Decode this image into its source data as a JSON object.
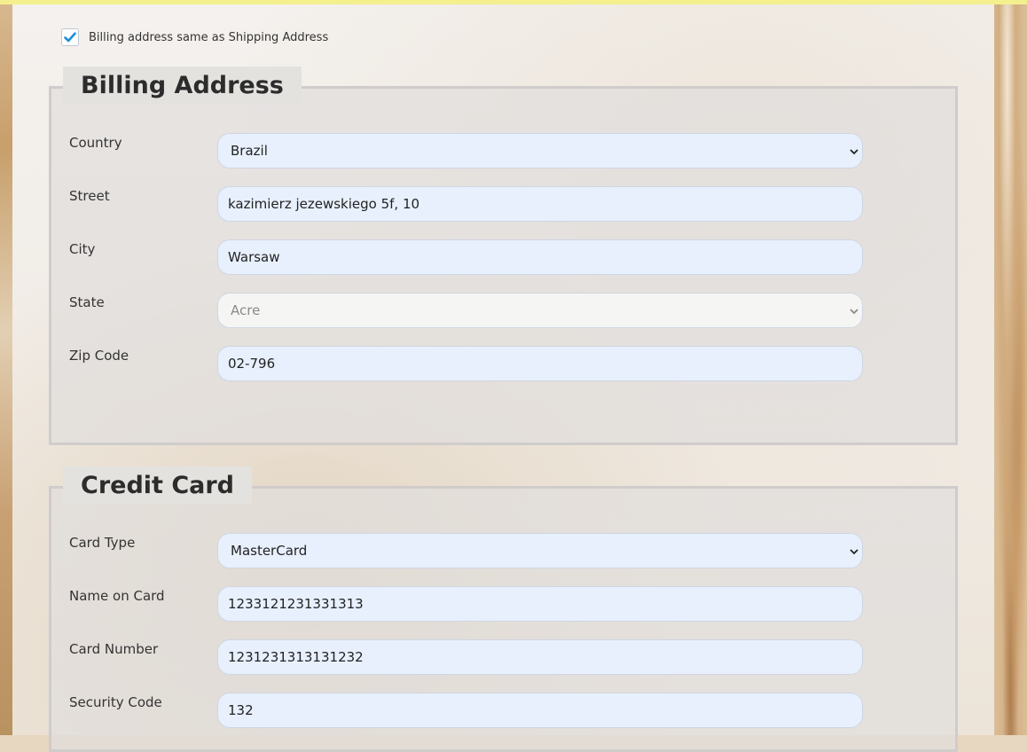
{
  "same_address": {
    "checked": true,
    "label": "Billing address same as Shipping Address"
  },
  "billing": {
    "title": "Billing Address",
    "fields": {
      "country": {
        "label": "Country",
        "value": "Brazil"
      },
      "street": {
        "label": "Street",
        "value": "kazimierz jezewskiego 5f, 10"
      },
      "city": {
        "label": "City",
        "value": "Warsaw"
      },
      "state": {
        "label": "State",
        "value": "Acre"
      },
      "zip": {
        "label": "Zip Code",
        "value": "02-796"
      }
    }
  },
  "credit_card": {
    "title": "Credit Card",
    "fields": {
      "card_type": {
        "label": "Card Type",
        "value": "MasterCard"
      },
      "name_on_card": {
        "label": "Name on Card",
        "value": "1233121231331313"
      },
      "card_number": {
        "label": "Card Number",
        "value": "1231231313131232"
      },
      "security_code": {
        "label": "Security Code",
        "value": "132"
      }
    }
  },
  "colors": {
    "input_bg": "#e8f0fe",
    "fieldset_border": "#cfcccb",
    "checkbox_accent": "#1a8fd9",
    "top_bar": "#f4f08d"
  },
  "icons": {
    "checkbox": "check-icon",
    "select": "chevron-down-icon"
  }
}
